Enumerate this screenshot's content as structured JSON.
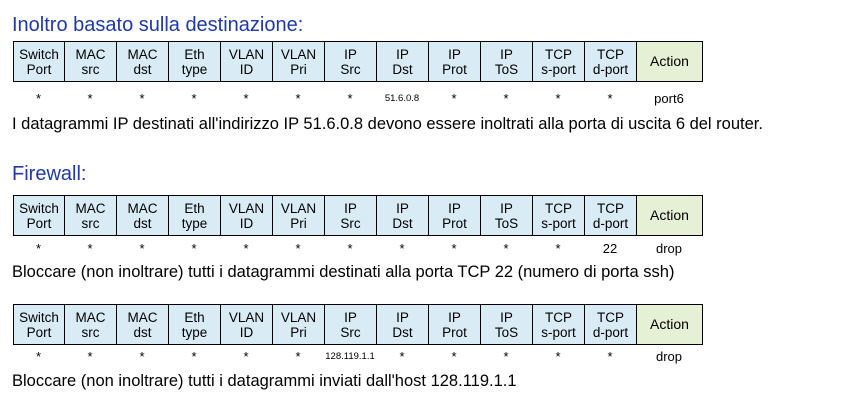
{
  "header_cells": [
    [
      "Switch",
      "Port"
    ],
    [
      "MAC",
      "src"
    ],
    [
      "MAC",
      "dst"
    ],
    [
      "Eth",
      "type"
    ],
    [
      "VLAN",
      "ID"
    ],
    [
      "VLAN",
      "Pri"
    ],
    [
      "IP",
      "Src"
    ],
    [
      "IP",
      "Dst"
    ],
    [
      "IP",
      "Prot"
    ],
    [
      "IP",
      "ToS"
    ],
    [
      "TCP",
      "s-port"
    ],
    [
      "TCP",
      "d-port"
    ]
  ],
  "action_header": "Action",
  "sections": [
    {
      "title": "Inoltro basato sulla destinazione:",
      "values": [
        "*",
        "*",
        "*",
        "*",
        "*",
        "*",
        "*",
        "51.6.0.8",
        "*",
        "*",
        "*",
        "*"
      ],
      "action": "port6",
      "description": "I datagrammi IP destinati all'indirizzo IP 51.6.0.8 devono essere inoltrati alla porta di uscita 6 del router."
    },
    {
      "title": "Firewall:",
      "values": [
        "*",
        "*",
        "*",
        "*",
        "*",
        "*",
        "*",
        "*",
        "*",
        "*",
        "*",
        "22"
      ],
      "action": "drop",
      "description": "Bloccare (non inoltrare) tutti i datagrammi destinati alla porta TCP 22 (numero di porta ssh)"
    },
    {
      "title": "",
      "values": [
        "*",
        "*",
        "*",
        "*",
        "*",
        "*",
        "128.119.1.1",
        "*",
        "*",
        "*",
        "*",
        "*"
      ],
      "action": "drop",
      "description": "Bloccare (non inoltrare) tutti i datagrammi inviati dall'host 128.119.1.1"
    }
  ]
}
